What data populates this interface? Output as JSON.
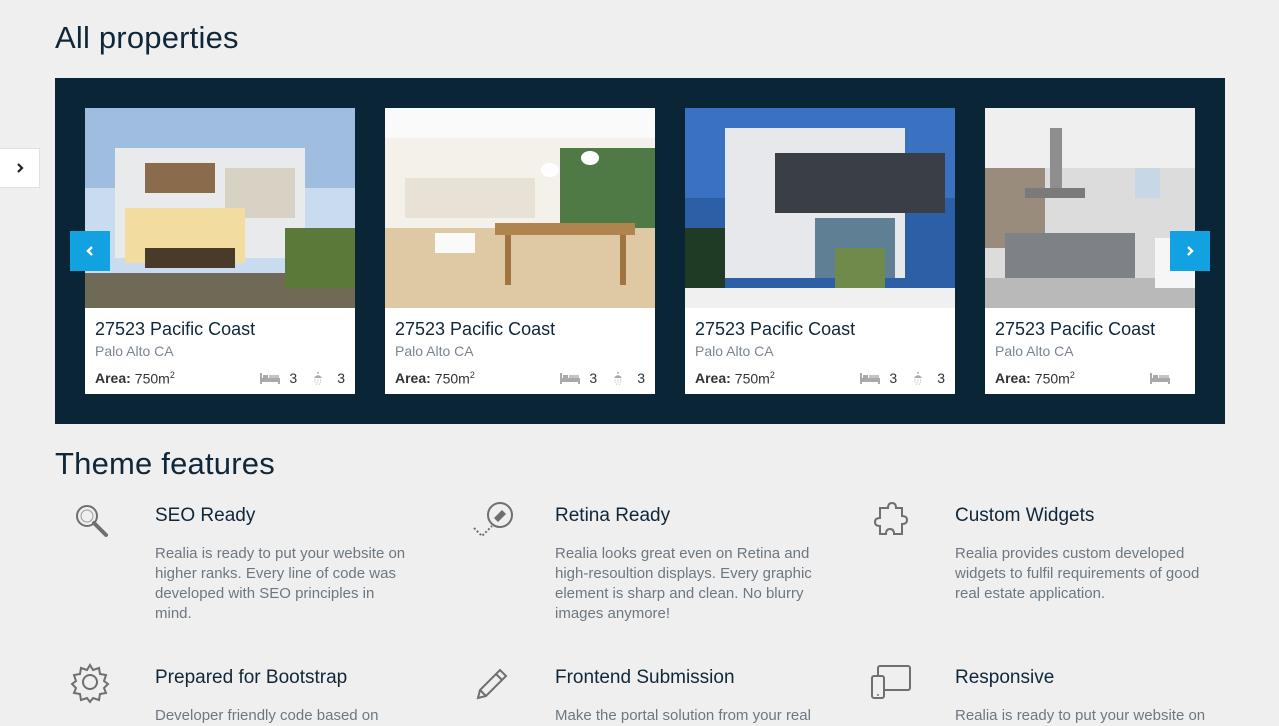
{
  "headings": {
    "all_properties": "All properties",
    "theme_features": "Theme features"
  },
  "properties": [
    {
      "name": "27523 Pacific Coast",
      "city": "Palo Alto CA",
      "area_label": "Area:",
      "area_value": "750m",
      "area_unit_sup": "2",
      "beds": "3",
      "baths": "3"
    },
    {
      "name": "27523 Pacific Coast",
      "city": "Palo Alto CA",
      "area_label": "Area:",
      "area_value": "750m",
      "area_unit_sup": "2",
      "beds": "3",
      "baths": "3"
    },
    {
      "name": "27523 Pacific Coast",
      "city": "Palo Alto CA",
      "area_label": "Area:",
      "area_value": "750m",
      "area_unit_sup": "2",
      "beds": "3",
      "baths": "3"
    },
    {
      "name": "27523 Pacific Coast",
      "city": "Palo Alto CA",
      "area_label": "Area:",
      "area_value": "750m",
      "area_unit_sup": "2",
      "beds": "",
      "baths": ""
    }
  ],
  "features": [
    {
      "icon": "magnifier-icon",
      "title": "SEO Ready",
      "desc": "Realia is ready to put your website on higher ranks. Every line of code was developed with SEO principles in mind."
    },
    {
      "icon": "retina-eye-icon",
      "title": "Retina Ready",
      "desc": "Realia looks great even on Retina and high-resoultion displays. Every graphic element is sharp and clean. No blurry images anymore!"
    },
    {
      "icon": "puzzle-piece-icon",
      "title": "Custom Widgets",
      "desc": "Realia provides custom developed widgets to fulfil requirements of good real estate application."
    },
    {
      "icon": "gear-icon",
      "title": "Prepared for Bootstrap",
      "desc": "Developer friendly code based on"
    },
    {
      "icon": "pencil-icon",
      "title": "Frontend Submission",
      "desc": "Make the portal solution from your real"
    },
    {
      "icon": "devices-icon",
      "title": "Responsive",
      "desc": "Realia is ready to put your website on"
    }
  ],
  "colors": {
    "carousel_bg": "#0a2636",
    "accent": "#13a2e1",
    "page_bg": "#efefef"
  }
}
